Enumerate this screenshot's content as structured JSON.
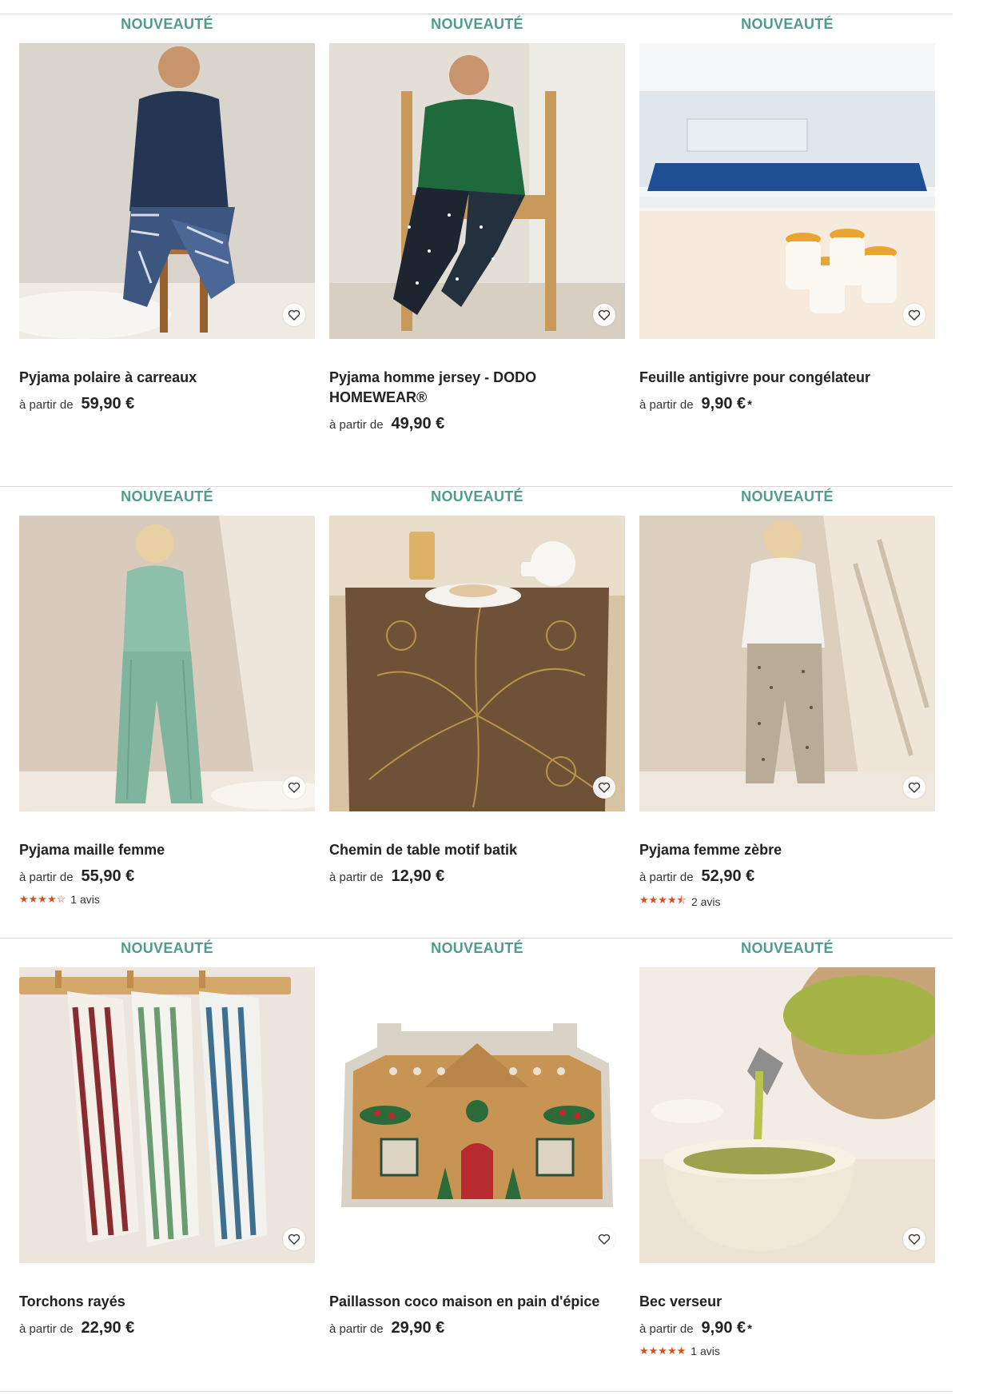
{
  "badge_label": "NOUVEAUTÉ",
  "price_prefix": "à partir de",
  "products": [
    {
      "name": "Pyjama polaire à carreaux",
      "price": "59,90 €",
      "asterisk": ""
    },
    {
      "name": "Pyjama homme jersey - DODO HOMEWEAR®",
      "price": "49,90 €",
      "asterisk": ""
    },
    {
      "name": "Feuille antigivre pour congélateur",
      "price": "9,90 €",
      "asterisk": "*"
    },
    {
      "name": "Pyjama maille femme",
      "price": "55,90 €",
      "asterisk": "",
      "stars": "★★★★☆",
      "reviews": "1 avis",
      "rating": 4
    },
    {
      "name": "Chemin de table motif batik",
      "price": "12,90 €",
      "asterisk": ""
    },
    {
      "name": "Pyjama femme zèbre",
      "price": "52,90 €",
      "asterisk": "",
      "stars": "★★★★⯪",
      "reviews": "2 avis",
      "rating": 4.5
    },
    {
      "name": "Torchons rayés",
      "price": "22,90 €",
      "asterisk": ""
    },
    {
      "name": "Paillasson coco maison en pain d'épice",
      "price": "29,90 €",
      "asterisk": ""
    },
    {
      "name": "Bec verseur",
      "price": "9,90 €",
      "asterisk": "*",
      "stars": "★★★★★",
      "reviews": "1 avis",
      "rating": 5
    }
  ],
  "colors": {
    "badge": "#4f9c8c",
    "stars": "#d9501f",
    "divider": "#d6d6d6"
  },
  "icons": {
    "favorite": "heart-icon",
    "star": "star-icon"
  }
}
